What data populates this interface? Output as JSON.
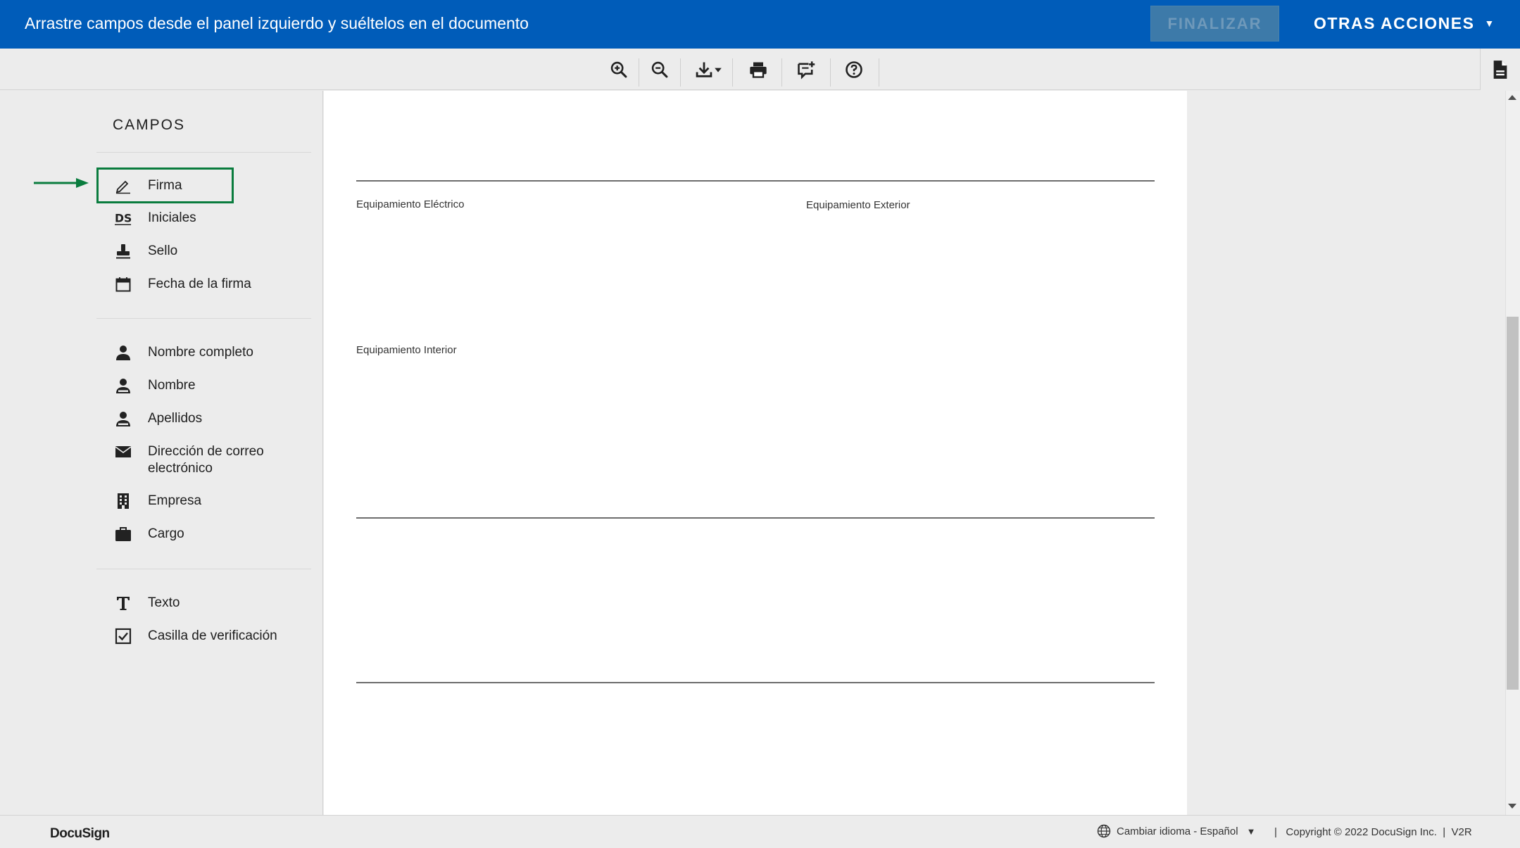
{
  "topbar": {
    "instructions": "Arrastre campos desde el panel izquierdo y suéltelos en el documento",
    "finalize_label": "FINALIZAR",
    "other_actions_label": "OTRAS ACCIONES",
    "other_actions_caret": "▼",
    "background_color": "#005cb9"
  },
  "toolbar": {
    "icons": [
      "zoom-in-icon",
      "zoom-out-icon",
      "download-icon",
      "print-icon",
      "comment-add-icon",
      "help-icon",
      "document-icon"
    ]
  },
  "sidebar": {
    "title": "CAMPOS",
    "groups": [
      [
        {
          "label": "Firma",
          "icon": "signature-pen-icon",
          "highlighted": true
        },
        {
          "label": "Iniciales",
          "icon": "initials-ds-icon"
        },
        {
          "label": "Sello",
          "icon": "stamp-icon"
        },
        {
          "label": "Fecha de la firma",
          "icon": "calendar-icon"
        }
      ],
      [
        {
          "label": "Nombre completo",
          "icon": "person-icon"
        },
        {
          "label": "Nombre",
          "icon": "person-outline-icon"
        },
        {
          "label": "Apellidos",
          "icon": "person-outline-icon"
        },
        {
          "label": "Dirección de correo electrónico",
          "icon": "envelope-icon"
        },
        {
          "label": "Empresa",
          "icon": "building-icon"
        },
        {
          "label": "Cargo",
          "icon": "briefcase-icon"
        }
      ],
      [
        {
          "label": "Texto",
          "icon": "text-t-icon"
        },
        {
          "label": "Casilla de verificación",
          "icon": "checkbox-icon"
        }
      ]
    ],
    "highlight_color": "#0a7c3e"
  },
  "document": {
    "labels": {
      "electrical": "Equipamiento Eléctrico",
      "exterior": "Equipamiento Exterior",
      "interior": "Equipamiento Interior"
    }
  },
  "footer": {
    "logo": "DocuSign",
    "language": "Cambiar idioma - Español",
    "language_caret": "▼",
    "copyright": "|   Copyright © 2022 DocuSign Inc.  |  V2R"
  }
}
